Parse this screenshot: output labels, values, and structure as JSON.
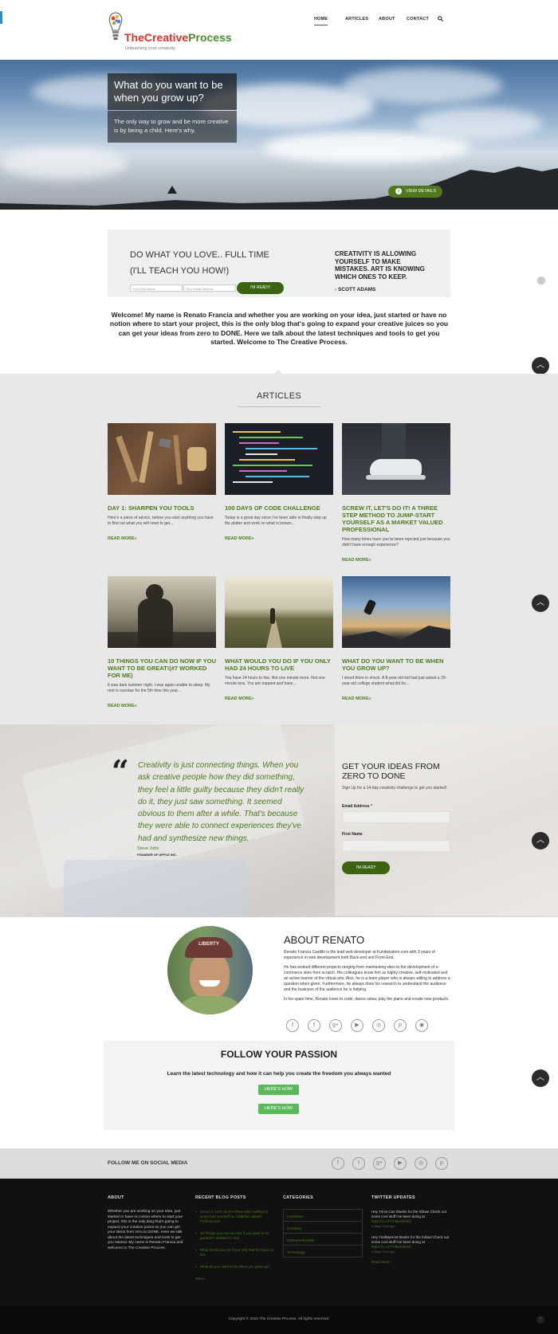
{
  "header": {
    "logo": {
      "brand_part1": "The",
      "brand_part2": "Creative",
      "brand_part3": "Process",
      "tagline": "Unleashing your creativity"
    },
    "nav": [
      {
        "label": "HOME"
      },
      {
        "label": "ARTICLES"
      },
      {
        "label": "ABOUT"
      },
      {
        "label": "CONTACT"
      }
    ],
    "search_icon": "search-icon"
  },
  "hero": {
    "title": "What do you want to be when you grow up?",
    "description": "The only way to grow and be more creative is by being a child. Here's why.",
    "button": "VIEW DETAILS"
  },
  "cta": {
    "line1": "DO WHAT YOU LOVE.. FULL TIME",
    "line2": "(I'LL TEACH YOU HOW!)",
    "first_name_placeholder": "Your First Name",
    "email_placeholder": "Your Email Address",
    "button": "I'M READY",
    "quote": "CREATIVITY IS ALLOWING YOURSELF TO MAKE MISTAKES. ART IS KNOWING WHICH ONES TO KEEP.",
    "quote_author": "- SCOTT ADAMS"
  },
  "welcome": "Welcome! My name is Renato Francia and whether you are working on your idea, just started or have no notion where to start your project, this is the only blog that's going to expand your creative juices so you can get your ideas from zero to DONE. Here we talk about the latest techniques and tools to get you started. Welcome to The Creative Process.",
  "articles": {
    "heading": "ARTICLES",
    "items": [
      {
        "title": "DAY 1: SHARPEN YOU TOOLS",
        "excerpt": "Here's a piece of advice, before you start anything you have to find out what you will need to get...",
        "read_more": "READ MORE»"
      },
      {
        "title": "100 DAYS OF CODE CHALLENGE",
        "excerpt": "Today is a great day since I've been able to finally step up the platter and work on what is known...",
        "read_more": "READ MORE»"
      },
      {
        "title": "SCREW IT, LET'S DO IT! A THREE STEP METHOD TO JUMP-START YOURSELF AS A MARKET VALUED PROFESSIONAL",
        "excerpt": "How many times have you've been rejected just because you didn't have enough experience?",
        "read_more": "READ MORE»"
      },
      {
        "title": "10 THINGS YOU CAN DO NOW IF YOU WANT TO BE GREAT!(#7 WORKED FOR ME)",
        "excerpt": "It was dark summer night. I was again unable to sleep. My rent is overdue for the 5th time this year...",
        "read_more": "READ MORE»"
      },
      {
        "title": "WHAT WOULD YOU DO IF YOU ONLY HAD 24 HOURS TO LIVE",
        "excerpt": "You have 24 hours to live. Not one minute more. Not one minute less. You are trapped and have...",
        "read_more": "READ MORE»"
      },
      {
        "title": "WHAT DO YOU WANT TO BE WHEN YOU GROW UP?",
        "excerpt": "I stood there in shock. A 8-year-old kid had just asked a 20-year-old college student what did he...",
        "read_more": "READ MORE»"
      }
    ]
  },
  "quote_section": {
    "quote": "Creativity is just connecting things. When you ask creative people how they did something, they feel a little guilty because they didn't really do it, they just saw something. It seemed obvious to them after a while. That's because they were able to connect experiences they've had and synthesize new things.",
    "author": "Steve Jobs",
    "role": "FOUNDER OF APPLE INC.",
    "signup": {
      "heading": "GET YOUR IDEAS FROM ZERO TO DONE",
      "sub": "Sign Up for a 14-day creativity challenge to get you started!",
      "email_label": "Email Address",
      "required": "*",
      "name_label": "First Name",
      "button": "I'M READY"
    }
  },
  "about": {
    "heading": "ABOUT RENATO",
    "p1": "Renato Francia Castillo is the lead web developer at Fundwisdom.com with 3 years of experience in web development both Back-end and Front-End.",
    "p2": "He has worked different projects ranging from maintaining sites to the development of e-commerce sites from scratch. His colleagues know him as highly creative, self-motivated and an active learner of the virtual arts. Also, he is a team player who is always willing to address a question when given. Furthermore, he always does his research to understand the audience and the business of the audience he is helping.",
    "p3": "In his spare time, Renato loves to code, dance salsa, play the piano and create new products.",
    "social_icons": [
      "facebook-icon",
      "twitter-icon",
      "google-plus-icon",
      "youtube-icon",
      "instagram-icon",
      "pinterest-icon",
      "github-icon"
    ],
    "cap_text": "LIBERTY"
  },
  "follow_passion": {
    "heading": "FOLLOW YOUR PASSION",
    "sub": "Learn the latest technology and how it can help you create the freedom you always wanted",
    "button1": "HERE'S HOW",
    "button2": "HERE'S HOW"
  },
  "social_bar": {
    "label": "FOLLOW ME ON SOCIAL MEDIA",
    "icons": [
      "facebook-icon",
      "twitter-icon",
      "google-plus-icon",
      "youtube-icon",
      "instagram-icon",
      "pinterest-icon"
    ]
  },
  "footer": {
    "about_heading": "ABOUT",
    "about_text": "Whether you are working on your idea, just started or have no notion where to start your project, this is the only blog that's going to expand your creative juices so you can get your ideas from zero to DONE. Here we talk about the latest techniques and tools to get you started. My name is Renato Francia and welcome to The Creative Process.",
    "recent_heading": "RECENT BLOG POSTS",
    "recent": [
      "Screw it, Let's do it! A three step method to jump-start yourself as a Market Valued Professional",
      "10 Things you can do now if you want to be great!(#7 worked for me)",
      "What would you do if you only had 24 hours to live",
      "What do you want to be when you grow up?"
    ],
    "recent_more": "More»",
    "categories_heading": "CATEGORIES",
    "categories": [
      "Inspiration",
      "Creativity",
      "Entrepreneurship",
      "Technology"
    ],
    "twitter_heading": "TWITTER UPDATES",
    "tweets": [
      {
        "text": "Hey Tricia Carr thanks for the follow! Check out some cool stuff I've been doing at",
        "link": "https://t.co/7YHfueWbaG",
        "time": "4 days 3 hrs ago"
      },
      {
        "text": "Hey FindMyHost thanks for the follow! Check out some cool stuff I've been doing at",
        "link": "https://t.co/7YHfueWbaG",
        "time": "4 days 3 hrs ago"
      }
    ],
    "read_more": "Read More»"
  },
  "copyright": "Copyright © 2015 The Creative Process. All rights reserved.",
  "colors": {
    "brand_green": "#4b7a1e",
    "button_green": "#3c6310",
    "passion_green": "#5cb85c",
    "footer_bg": "#111111"
  }
}
